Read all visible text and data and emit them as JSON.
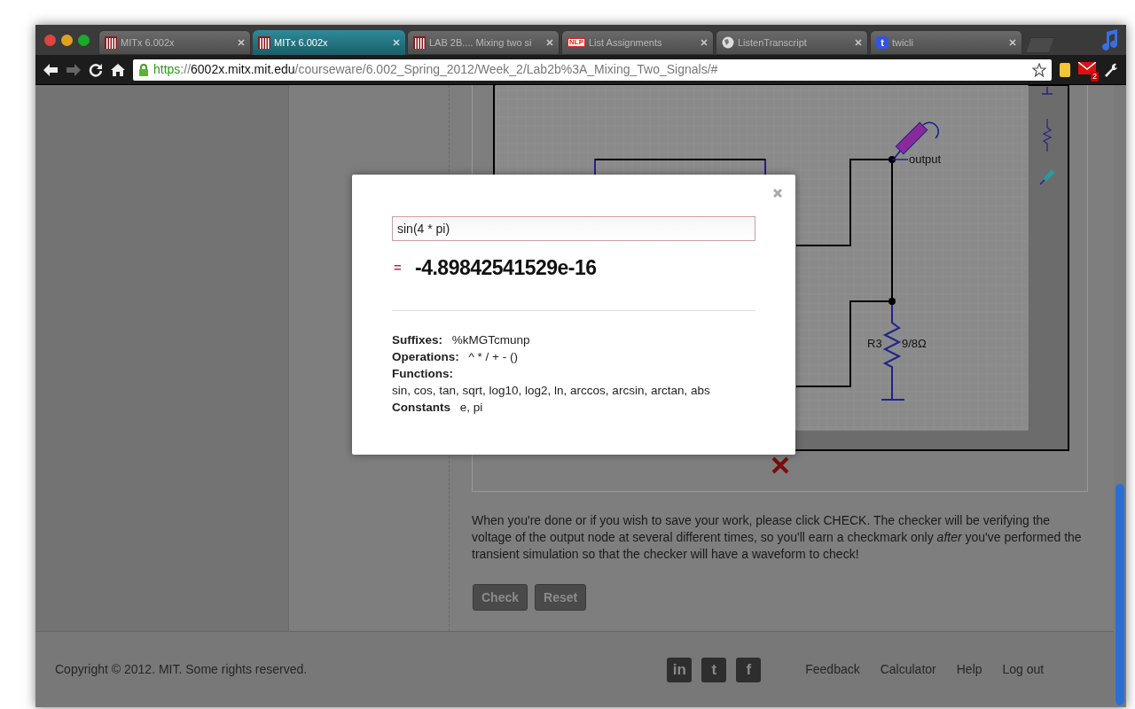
{
  "browser": {
    "tabs": [
      {
        "title": "MITx 6.002x",
        "kind": "mitx",
        "selected": false
      },
      {
        "title": "MITx 6.002x",
        "kind": "mitx",
        "selected": true
      },
      {
        "title": "LAB 2B.... Mixing two si",
        "kind": "mitx",
        "selected": false
      },
      {
        "title": "List Assignments",
        "kind": "nlp",
        "favicon_text": "NLP",
        "selected": false
      },
      {
        "title": "ListenTranscript",
        "kind": "globe",
        "selected": false
      },
      {
        "title": "twicli",
        "kind": "twicli",
        "favicon_text": "t",
        "selected": false
      }
    ],
    "url": {
      "scheme": "https",
      "separator": "://",
      "host": "6002x.mitx.mit.edu",
      "path": "/courseware/6.002_Spring_2012/Week_2/Lab2b%3A_Mixing_Two_Signals/#"
    },
    "mail_badge": "2"
  },
  "schematic": {
    "node_label": "output",
    "resistor_name": "R3",
    "resistor_value": "9/8Ω"
  },
  "calculator": {
    "input": "sin(4 * pi)",
    "equals": "=",
    "result": "-4.89842541529e-16",
    "help": [
      {
        "label": "Suffixes:",
        "value": "%kMGTcmunp",
        "kind": "inline"
      },
      {
        "label": "Operations:",
        "value": "^ * / + - ()",
        "kind": "inline"
      },
      {
        "label": "Functions:",
        "value": "sin, cos, tan, sqrt, log10, log2, ln, arccos, arcsin, arctan, abs",
        "kind": "block"
      },
      {
        "label": "Constants",
        "value": "e, pi",
        "kind": "inline"
      }
    ]
  },
  "instructions": "When you're done or if you wish to save your work, please click CHECK. The checker will be verifying the voltage of the output node at several different times, so you'll earn a checkmark only *after* you've performed the transient simulation so that the checker will have a waveform to check!",
  "buttons": [
    "Check",
    "Reset"
  ],
  "footer": {
    "copyright": "Copyright © 2012. MIT. Some rights reserved.",
    "social": [
      {
        "glyph": "in"
      },
      {
        "glyph": "t"
      },
      {
        "glyph": "f"
      }
    ],
    "links": [
      "Feedback",
      "Calculator",
      "Help",
      "Log out"
    ]
  }
}
